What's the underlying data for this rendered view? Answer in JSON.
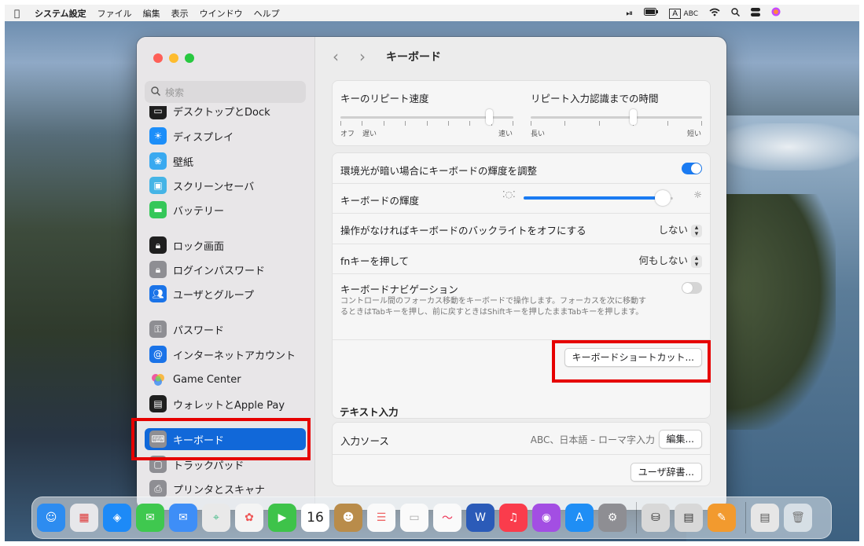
{
  "menubar": {
    "app": "システム設定",
    "items": [
      "ファイル",
      "編集",
      "表示",
      "ウインドウ",
      "ヘルプ"
    ],
    "input_mode": "A",
    "input_label": "ABC"
  },
  "window": {
    "title": "キーボード",
    "search_placeholder": "検索",
    "sidebar": [
      {
        "label": "デスクトップとDock",
        "icon": "dock-icon",
        "color": "#1f1f1f"
      },
      {
        "label": "ディスプレイ",
        "icon": "sun-icon",
        "color": "#1c8ef9"
      },
      {
        "label": "壁紙",
        "icon": "flower-icon",
        "color": "#39a9f0"
      },
      {
        "label": "スクリーンセーバ",
        "icon": "screensaver-icon",
        "color": "#45b4e6"
      },
      {
        "label": "バッテリー",
        "icon": "battery-icon",
        "color": "#35c759"
      },
      {
        "label": "ロック画面",
        "icon": "lock-icon",
        "color": "#1f1f1f"
      },
      {
        "label": "ログインパスワード",
        "icon": "lock-icon",
        "color": "#8e8e93"
      },
      {
        "label": "ユーザとグループ",
        "icon": "users-icon",
        "color": "#1a73e8"
      },
      {
        "label": "パスワード",
        "icon": "key-icon",
        "color": "#8e8e93"
      },
      {
        "label": "インターネットアカウント",
        "icon": "at-icon",
        "color": "#1a73e8"
      },
      {
        "label": "Game Center",
        "icon": "gamecenter-icon",
        "color": "#ffffff"
      },
      {
        "label": "ウォレットとApple Pay",
        "icon": "wallet-icon",
        "color": "#1f1f1f"
      },
      {
        "label": "キーボード",
        "icon": "keyboard-icon",
        "color": "#8e8e93"
      },
      {
        "label": "トラックパッド",
        "icon": "trackpad-icon",
        "color": "#8e8e93"
      },
      {
        "label": "プリンタとスキャナ",
        "icon": "printer-icon",
        "color": "#8e8e93"
      }
    ],
    "repeat": {
      "speed_label": "キーのリピート速度",
      "speed_left1": "オフ",
      "speed_left2": "遅い",
      "speed_right": "速い",
      "speed_value": 0.86,
      "delay_label": "リピート入力認識までの時間",
      "delay_left": "長い",
      "delay_right": "短い",
      "delay_value": 0.6
    },
    "backlight": {
      "adjust_label": "環境光が暗い場合にキーボードの輝度を調整",
      "adjust_on": true,
      "brightness_label": "キーボードの輝度",
      "brightness_value": 0.93,
      "off_label": "操作がなければキーボードのバックライトをオフにする",
      "off_value": "しない",
      "fn_label": "fnキーを押して",
      "fn_value": "何もしない",
      "nav_label": "キーボードナビゲーション",
      "nav_desc": "コントロール間のフォーカス移動をキーボードで操作します。フォーカスを次に移動するときはTabキーを押し、前に戻すときはShiftキーを押したままTabキーを押します。",
      "nav_on": false,
      "shortcut_button": "キーボードショートカット..."
    },
    "text_input": {
      "section_title": "テキスト入力",
      "source_label": "入力ソース",
      "source_value": "ABC、日本語 – ローマ字入力",
      "edit_button": "編集...",
      "dict_button": "ユーザ辞書..."
    }
  },
  "dock": {
    "calendar_day": "16"
  },
  "colors": {
    "accent": "#1a7bf2",
    "highlight": "#e60000",
    "selected": "#1168d9"
  }
}
